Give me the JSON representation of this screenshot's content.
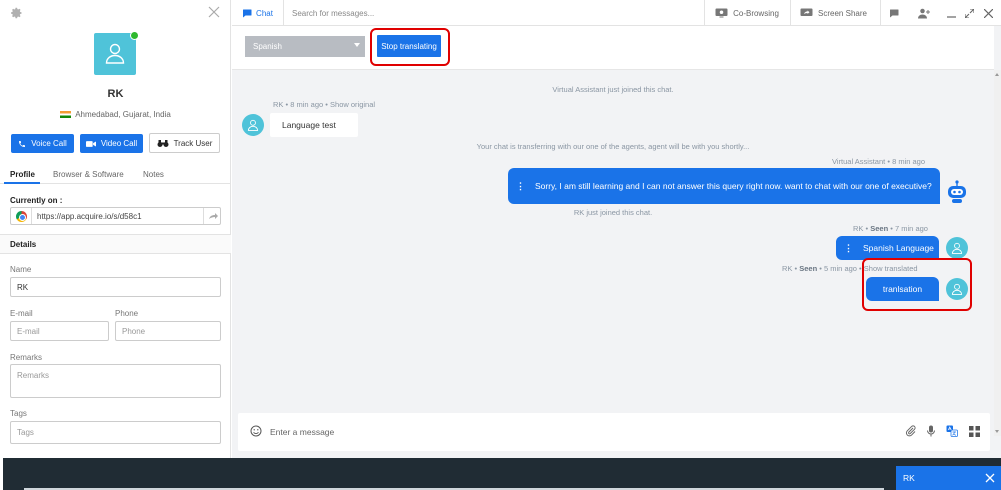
{
  "sidebar": {
    "visitor_name": "RK",
    "location": "Ahmedabad, Gujarat, India",
    "voice_call_label": "Voice Call",
    "video_call_label": "Video Call",
    "track_user_label": "Track User",
    "tabs": [
      {
        "label": "Profile",
        "active": true
      },
      {
        "label": "Browser & Software",
        "active": false
      },
      {
        "label": "Notes",
        "active": false
      }
    ],
    "currently_on_label": "Currently on :",
    "current_url": "https://app.acquire.io/s/d58c1",
    "details_label": "Details",
    "name_label": "Name",
    "name_value": "RK",
    "email_label": "E-mail",
    "email_placeholder": "E-mail",
    "phone_label": "Phone",
    "phone_placeholder": "Phone",
    "remarks_label": "Remarks",
    "remarks_placeholder": "Remarks",
    "tags_label": "Tags",
    "tags_placeholder": "Tags"
  },
  "header": {
    "chat_tab_label": "Chat",
    "search_placeholder": "Search for messages...",
    "cobrowsing_label": "Co-Browsing",
    "screen_share_label": "Screen Share"
  },
  "translation": {
    "selected_language": "Spanish",
    "stop_label": "Stop translating"
  },
  "messages": {
    "sys_joined_va": "Virtual Assistant just joined this chat.",
    "m1_sender": "RK",
    "m1_time": "8 min ago",
    "m1_action": "Show original",
    "m1_text": "Language test",
    "sys_transfer": "Your chat is transferring with our one of the agents, agent will be with you shortly...",
    "m2_sender": "Virtual Assistant",
    "m2_time": "8 min ago",
    "m2_text": "Sorry, I am still learning and I can not answer this query right now. want to chat with our one of executive?",
    "sys_joined_rk": "RK just joined this chat.",
    "m3_sender": "RK",
    "m3_status": "Seen",
    "m3_time": "7 min ago",
    "m3_text": "Spanish Language",
    "m4_sender": "RK",
    "m4_status": "Seen",
    "m4_time": "5 min ago",
    "m4_action": "Show translated",
    "m4_text": "tranlsation",
    "separator": "•"
  },
  "composer": {
    "placeholder": "Enter a message"
  },
  "bottom_bar": {
    "chat_tab_label": "RK"
  },
  "colors": {
    "accent": "#1a73e8",
    "highlight_frame": "#e00000",
    "avatar": "#4fc3d9",
    "online": "#2eb82e"
  }
}
